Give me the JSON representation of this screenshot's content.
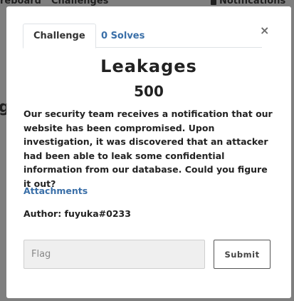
{
  "background_nav": {
    "scoreboard": "reboard",
    "challenges": "Challenges",
    "notifications": "Notifications",
    "partial_heading": "g"
  },
  "tabs": [
    {
      "label": "Challenge",
      "active": true
    },
    {
      "label": "0 Solves",
      "active": false
    }
  ],
  "close_symbol": "×",
  "challenge": {
    "name": "Leakages",
    "value": "500",
    "description": "Our security team receives a notification that our website has been compromised. Upon investigation, it was discovered that an attacker had been able to leak some confidential information from our database. Could you figure it out?",
    "attachments_label": "Attachments",
    "author": "Author: fuyuka#0233"
  },
  "form": {
    "flag_placeholder": "Flag",
    "submit_label": "Submit"
  },
  "colors": {
    "link": "#3a6fa8",
    "backdrop": "#7f7f7f"
  }
}
